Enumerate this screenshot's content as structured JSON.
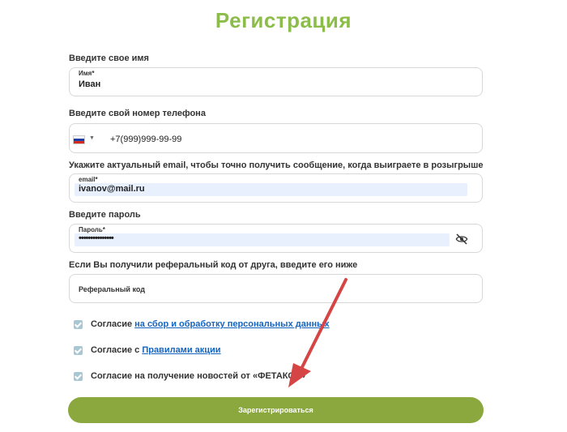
{
  "title": "Регистрация",
  "name": {
    "label": "Введите свое имя",
    "float_label": "Имя*",
    "value": "Иван"
  },
  "phone": {
    "label": "Введите свой номер телефона",
    "value": "+7(999)999-99-99",
    "country_icon": "russia-flag"
  },
  "email": {
    "label": "Укажите актуальный email, чтобы точно получить сообщение, когда выиграете в розыгрыше",
    "float_label": "email*",
    "value": "ivanov@mail.ru"
  },
  "password": {
    "label": "Введите пароль",
    "float_label": "Пароль*",
    "value": "•••••••••••••••",
    "toggle_icon": "eye-off-icon"
  },
  "referral": {
    "label": "Если Вы получили реферальный код от друга, введите его ниже",
    "placeholder": "Реферальный код"
  },
  "consents": [
    {
      "text": "Согласие ",
      "link": "на сбор и обработку персональных данных",
      "checked": true
    },
    {
      "text": "Согласие с ",
      "link": "Правилами акции",
      "checked": true
    },
    {
      "text": "Согласие на получение новостей от «ФЕТАКСА»",
      "link": "",
      "checked": true
    }
  ],
  "submit_label": "Зарегистрироваться",
  "colors": {
    "accent": "#8cbd4a",
    "button": "#8aa83e",
    "link": "#1565c0",
    "arrow": "#d64545"
  }
}
